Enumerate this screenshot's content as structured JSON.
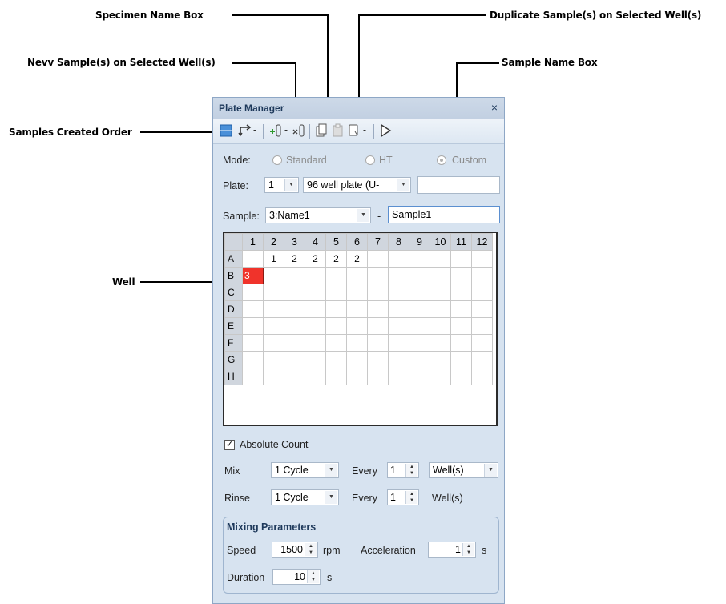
{
  "callouts": {
    "specimen_name_box": "Specimen Name Box",
    "duplicate_samples": "Duplicate Sample(s) on Selected Well(s)",
    "new_samples": "Nevv Sample(s) on Selected Well(s)",
    "sample_name_box": "Sample Name Box",
    "samples_created_order": "Samples Created Order",
    "well": "Well"
  },
  "panel": {
    "title": "Plate Manager",
    "close_glyph": "×"
  },
  "toolbar": {
    "icons": [
      "grid-view-icon",
      "sort-order-icon",
      "new-sample-icon",
      "delete-sample-icon",
      "copy-icon",
      "paste-icon",
      "duplicate-icon",
      "run-icon"
    ]
  },
  "mode": {
    "label": "Mode:",
    "options": [
      "Standard",
      "HT",
      "Custom"
    ],
    "selected": "Custom"
  },
  "plate": {
    "label": "Plate:",
    "number": "1",
    "type": "96 well plate (U-",
    "name": ""
  },
  "sample": {
    "label": "Sample:",
    "specimen": "3:Name1",
    "separator": "-",
    "name": "Sample1"
  },
  "grid": {
    "columns": [
      "1",
      "2",
      "3",
      "4",
      "5",
      "6",
      "7",
      "8",
      "9",
      "10",
      "11",
      "12"
    ],
    "rows": [
      "A",
      "B",
      "C",
      "D",
      "E",
      "F",
      "G",
      "H"
    ],
    "cells": {
      "A": [
        "",
        "1",
        "2",
        "2",
        "2",
        "2",
        "",
        "",
        "",
        "",
        "",
        ""
      ],
      "B": [
        "3",
        "",
        "",
        "",
        "",
        "",
        "",
        "",
        "",
        "",
        "",
        ""
      ]
    },
    "highlight": {
      "row": "B",
      "col": 1,
      "color": "#f0332b"
    }
  },
  "absolute_count": {
    "label": "Absolute Count",
    "checked": true,
    "glyph": "✓"
  },
  "mix": {
    "label": "Mix",
    "cycle": "1 Cycle",
    "every_label": "Every",
    "every_value": "1",
    "unit": "Well(s)"
  },
  "rinse": {
    "label": "Rinse",
    "cycle": "1 Cycle",
    "every_label": "Every",
    "every_value": "1",
    "unit": "Well(s)"
  },
  "mixing_parameters": {
    "title": "Mixing Parameters",
    "speed_label": "Speed",
    "speed_value": "1500",
    "speed_unit": "rpm",
    "accel_label": "Acceleration",
    "accel_value": "1",
    "accel_unit": "s",
    "duration_label": "Duration",
    "duration_value": "10",
    "duration_unit": "s"
  }
}
